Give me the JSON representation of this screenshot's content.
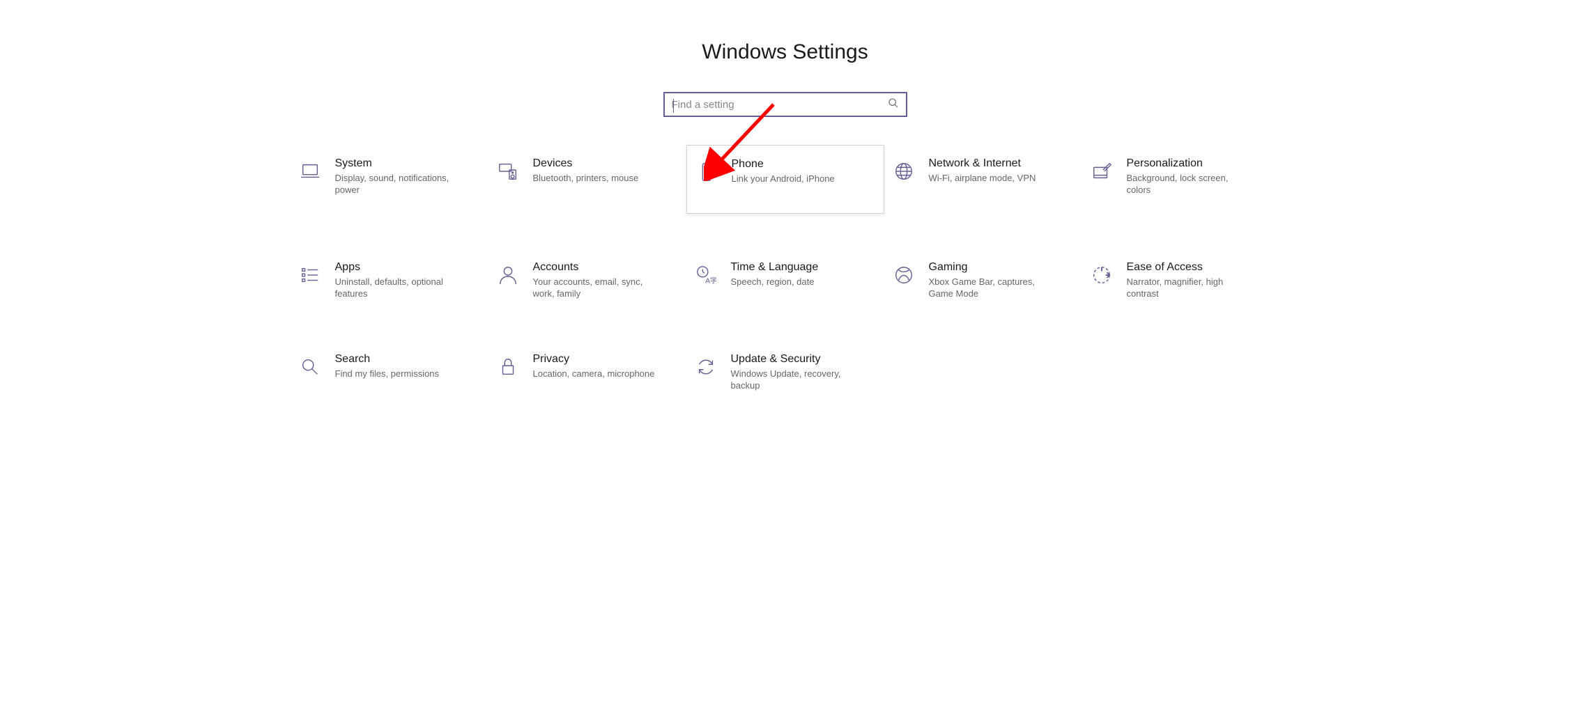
{
  "title": "Windows Settings",
  "search": {
    "placeholder": "Find a setting",
    "value": ""
  },
  "tiles": [
    {
      "id": "system",
      "title": "System",
      "desc": "Display, sound, notifications, power"
    },
    {
      "id": "devices",
      "title": "Devices",
      "desc": "Bluetooth, printers, mouse"
    },
    {
      "id": "phone",
      "title": "Phone",
      "desc": "Link your Android, iPhone",
      "hovered": true
    },
    {
      "id": "network",
      "title": "Network & Internet",
      "desc": "Wi-Fi, airplane mode, VPN"
    },
    {
      "id": "personalization",
      "title": "Personalization",
      "desc": "Background, lock screen, colors"
    },
    {
      "id": "apps",
      "title": "Apps",
      "desc": "Uninstall, defaults, optional features"
    },
    {
      "id": "accounts",
      "title": "Accounts",
      "desc": "Your accounts, email, sync, work, family"
    },
    {
      "id": "time",
      "title": "Time & Language",
      "desc": "Speech, region, date"
    },
    {
      "id": "gaming",
      "title": "Gaming",
      "desc": "Xbox Game Bar, captures, Game Mode"
    },
    {
      "id": "ease",
      "title": "Ease of Access",
      "desc": "Narrator, magnifier, high contrast"
    },
    {
      "id": "search",
      "title": "Search",
      "desc": "Find my files, permissions"
    },
    {
      "id": "privacy",
      "title": "Privacy",
      "desc": "Location, camera, microphone"
    },
    {
      "id": "update",
      "title": "Update & Security",
      "desc": "Windows Update, recovery, backup"
    }
  ],
  "annotation": {
    "arrow_points_to": "network"
  },
  "colors": {
    "accent": "#6b5b95",
    "arrow": "#ff0000"
  }
}
